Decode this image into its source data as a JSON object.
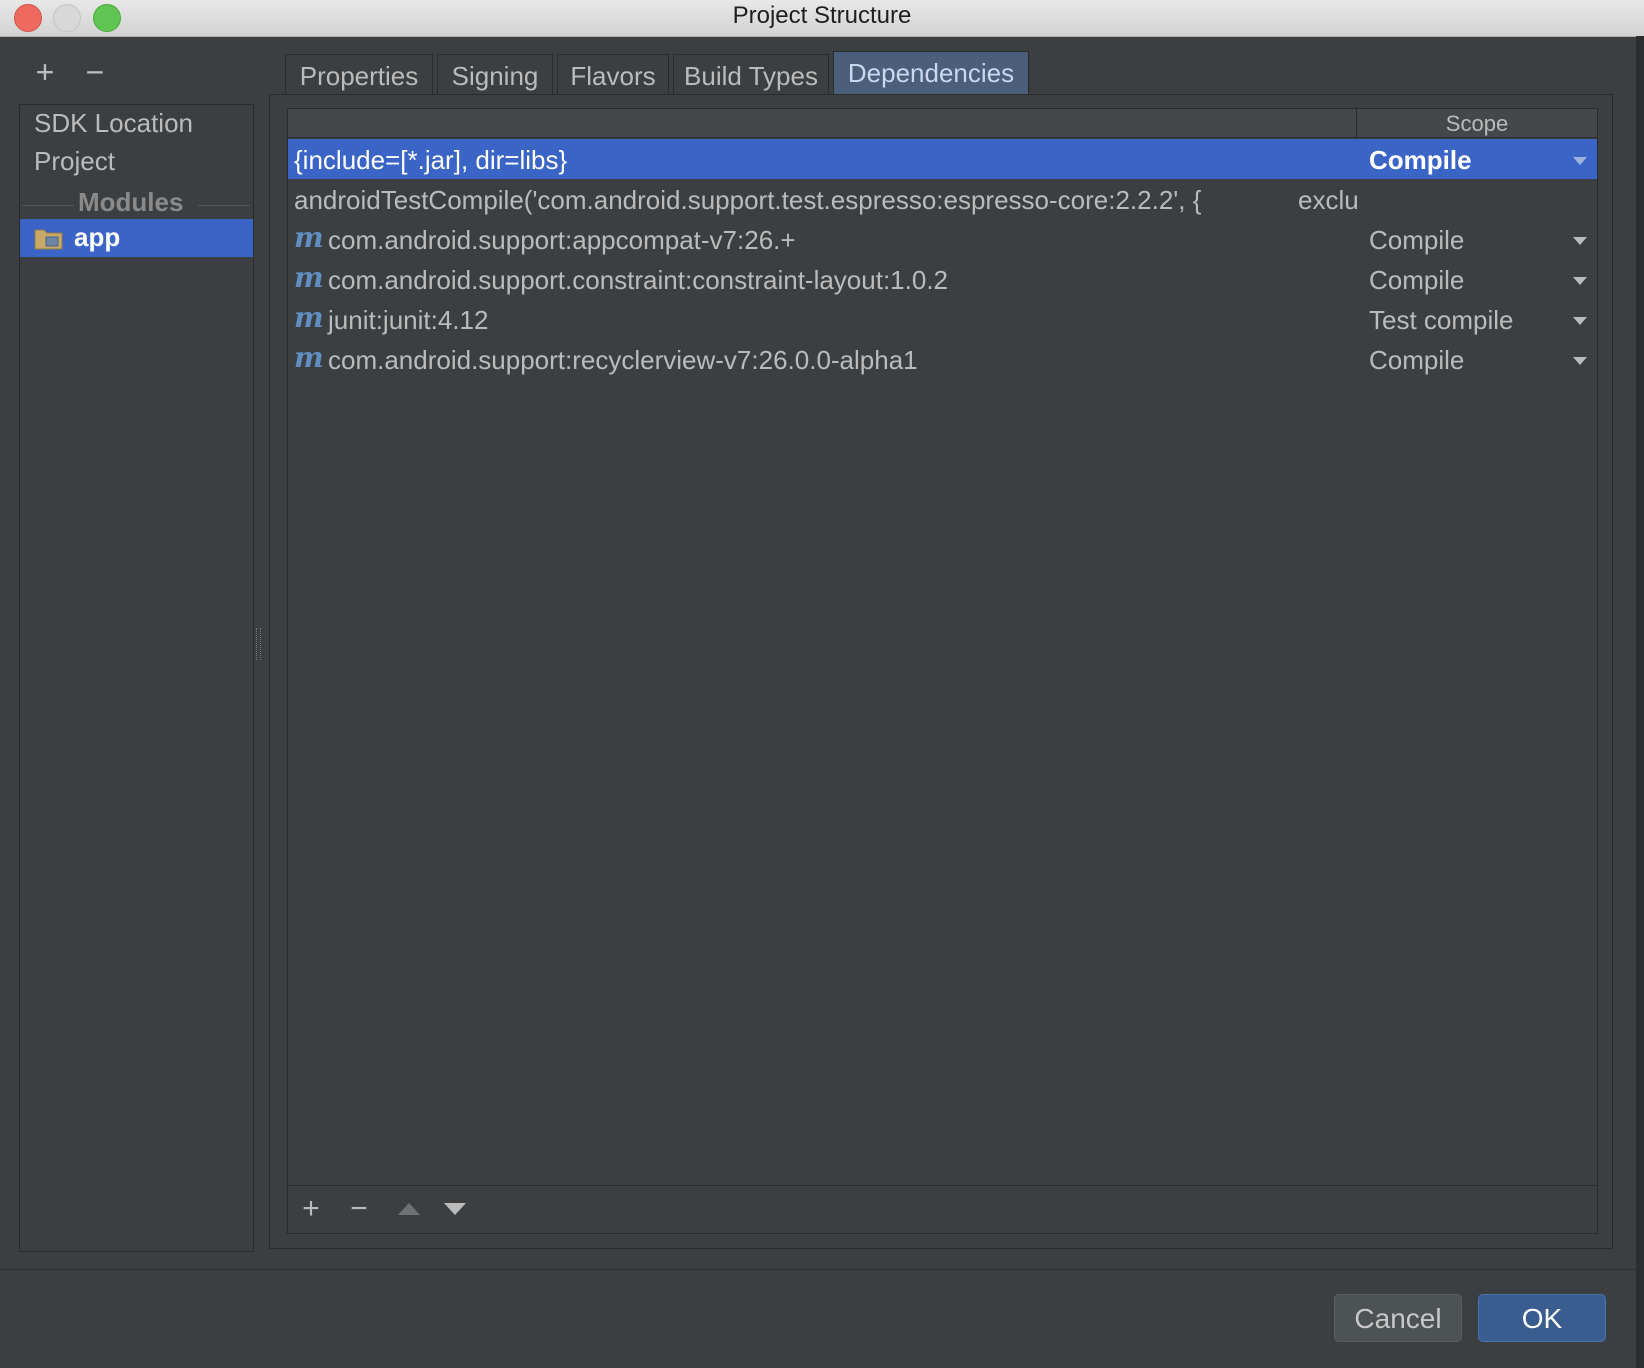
{
  "window": {
    "title": "Project Structure"
  },
  "left_toolbar": {
    "add": "+",
    "remove": "−"
  },
  "nav": {
    "items": [
      "SDK Location",
      "Project"
    ],
    "section": "Modules",
    "modules": [
      {
        "label": "app",
        "icon": "module-folder-icon",
        "selected": true
      }
    ]
  },
  "tabs": [
    "Properties",
    "Signing",
    "Flavors",
    "Build Types",
    "Dependencies"
  ],
  "active_tab": "Dependencies",
  "table": {
    "columns": [
      "",
      "Scope"
    ],
    "rows": [
      {
        "icon": "",
        "name": "{include=[*.jar], dir=libs}",
        "extra": "",
        "scope": "Compile",
        "selected": true
      },
      {
        "icon": "",
        "name": "androidTestCompile('com.android.support.test.espresso:espresso-core:2.2.2', {",
        "extra": "exclu",
        "scope": "",
        "selected": false
      },
      {
        "icon": "m",
        "name": "com.android.support:appcompat-v7:26.+",
        "extra": "",
        "scope": "Compile",
        "selected": false
      },
      {
        "icon": "m",
        "name": "com.android.support.constraint:constraint-layout:1.0.2",
        "extra": "",
        "scope": "Compile",
        "selected": false
      },
      {
        "icon": "m",
        "name": "junit:junit:4.12",
        "extra": "",
        "scope": "Test compile",
        "selected": false
      },
      {
        "icon": "m",
        "name": "com.android.support:recyclerview-v7:26.0.0-alpha1",
        "extra": "",
        "scope": "Compile",
        "selected": false
      }
    ],
    "toolbar": {
      "add": "+",
      "remove": "−"
    }
  },
  "buttons": {
    "cancel": "Cancel",
    "ok": "OK"
  },
  "colors": {
    "selection": "#3a64c5",
    "background": "#3c3f41",
    "active_tab": "#4b5e7a"
  }
}
